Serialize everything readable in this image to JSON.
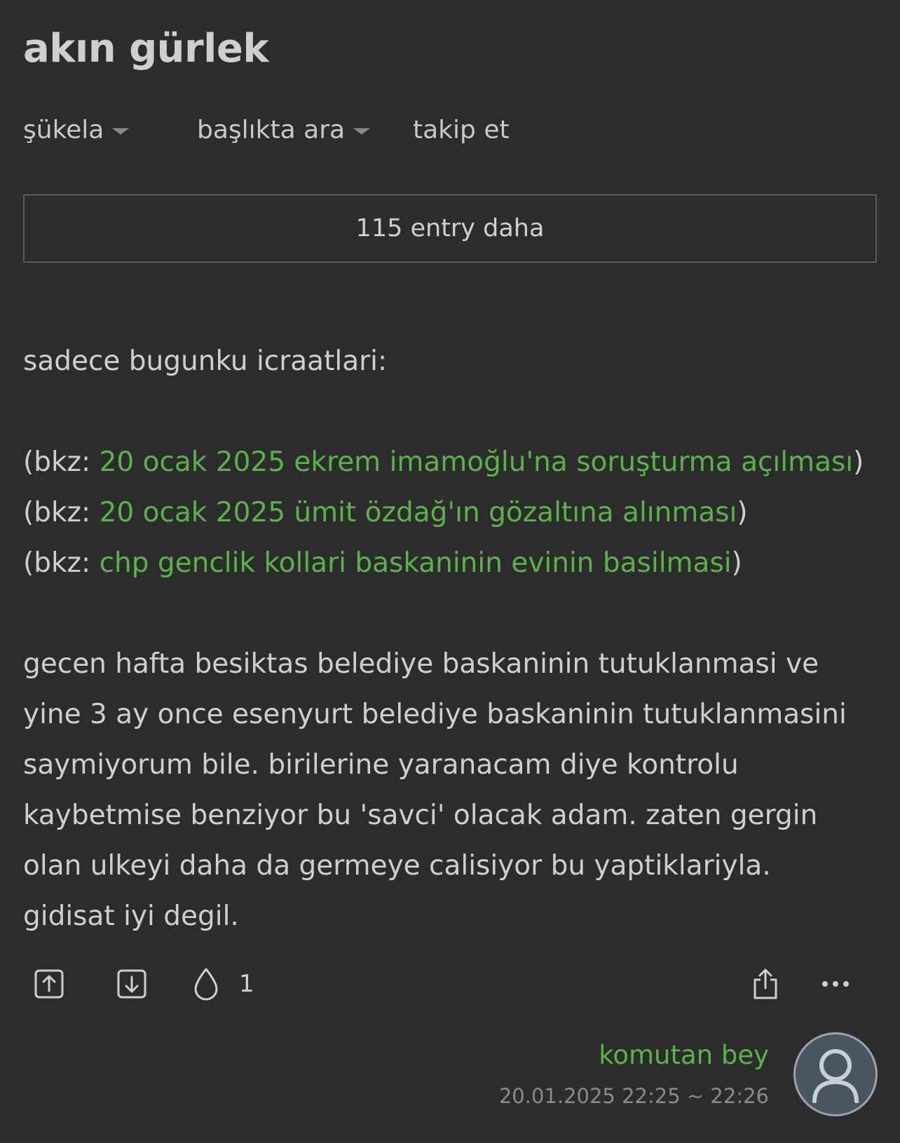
{
  "topic": {
    "title": "akın gürlek"
  },
  "nav": {
    "sort_label": "şükela",
    "search_label": "başlıkta ara",
    "follow_label": "takip et"
  },
  "more_entries": {
    "label": "115 entry daha"
  },
  "entry": {
    "intro": "sadece bugunku icraatlari:",
    "bkz": [
      {
        "prefix": "(bkz: ",
        "link": "20 ocak 2025 ekrem imamoğlu'na soruşturma açılması",
        "suffix": ")"
      },
      {
        "prefix": "(bkz: ",
        "link": "20 ocak 2025 ümit özdağ'ın gözaltına alınması",
        "suffix": ")"
      },
      {
        "prefix": "(bkz: ",
        "link": "chp genclik kollari baskaninin evinin basilmasi",
        "suffix": ")"
      }
    ],
    "body_lines": [
      "gecen hafta besiktas belediye baskaninin tutuklanmasi ve",
      "yine 3 ay once esenyurt belediye baskaninin tutuklanmasini",
      "saymiyorum bile. birilerine yaranacam diye kontrolu",
      "kaybetmise benziyor bu 'savci' olacak adam. zaten gergin",
      "olan ulkeyi daha da germeye calisiyor bu yaptiklariyla.",
      "gidisat iyi degil."
    ],
    "favorite_count": "1",
    "author": "komutan bey",
    "date": "20.01.2025 22:25 ~ 22:26"
  },
  "icons": {
    "upvote": "upvote-icon",
    "downvote": "downvote-icon",
    "favorite": "drop-icon",
    "share": "share-icon",
    "more": "more-icon",
    "avatar": "user-avatar-icon"
  },
  "colors": {
    "background": "#2c2c2c",
    "text": "#cfcfcf",
    "link": "#5ab34a",
    "muted": "#8a8a8a"
  }
}
